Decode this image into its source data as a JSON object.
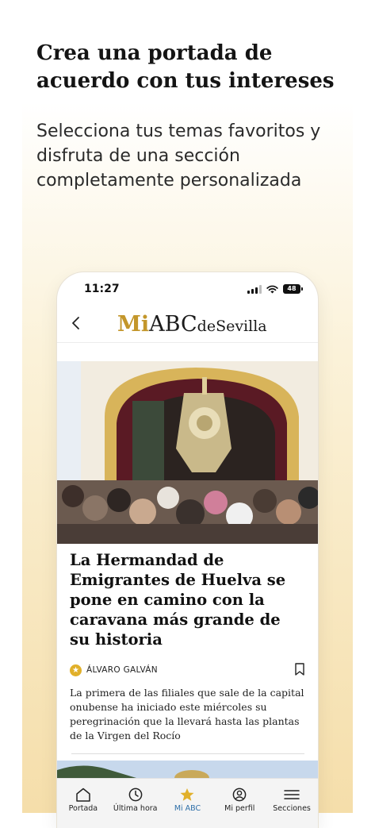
{
  "promo": {
    "headline": "Crea una portada de acuerdo con tus intereses",
    "subtext": "Selecciona tus temas favoritos y disfruta de una sección completamente personalizada"
  },
  "status_bar": {
    "time": "11:27",
    "battery": "48"
  },
  "header": {
    "logo_mi": "Mi",
    "logo_abc": "ABC",
    "logo_city": "deSevilla"
  },
  "article": {
    "title": "La Hermandad de Emigrantes de Huelva se pone en camino con la caravana más grande de su historia",
    "author": "ÁLVARO GALVÁN",
    "excerpt": "La primera de las filiales que sale de la capital onubense ha iniciado este miércoles su peregrinación que la llevará hasta las plantas de la Virgen del Rocío"
  },
  "tabbar": {
    "items": [
      {
        "label": "Portada",
        "icon": "house-icon",
        "active": false
      },
      {
        "label": "Última hora",
        "icon": "clock-icon",
        "active": false
      },
      {
        "label": "Mi ABC",
        "icon": "star-icon",
        "active": true
      },
      {
        "label": "Mi perfil",
        "icon": "profile-icon",
        "active": false
      },
      {
        "label": "Secciones",
        "icon": "menu-icon",
        "active": false
      }
    ]
  },
  "colors": {
    "accent": "#c3962a",
    "active_tab": "#2e6fa8",
    "star": "#e1b02a",
    "promo_gradient_end": "#f5deaa"
  }
}
